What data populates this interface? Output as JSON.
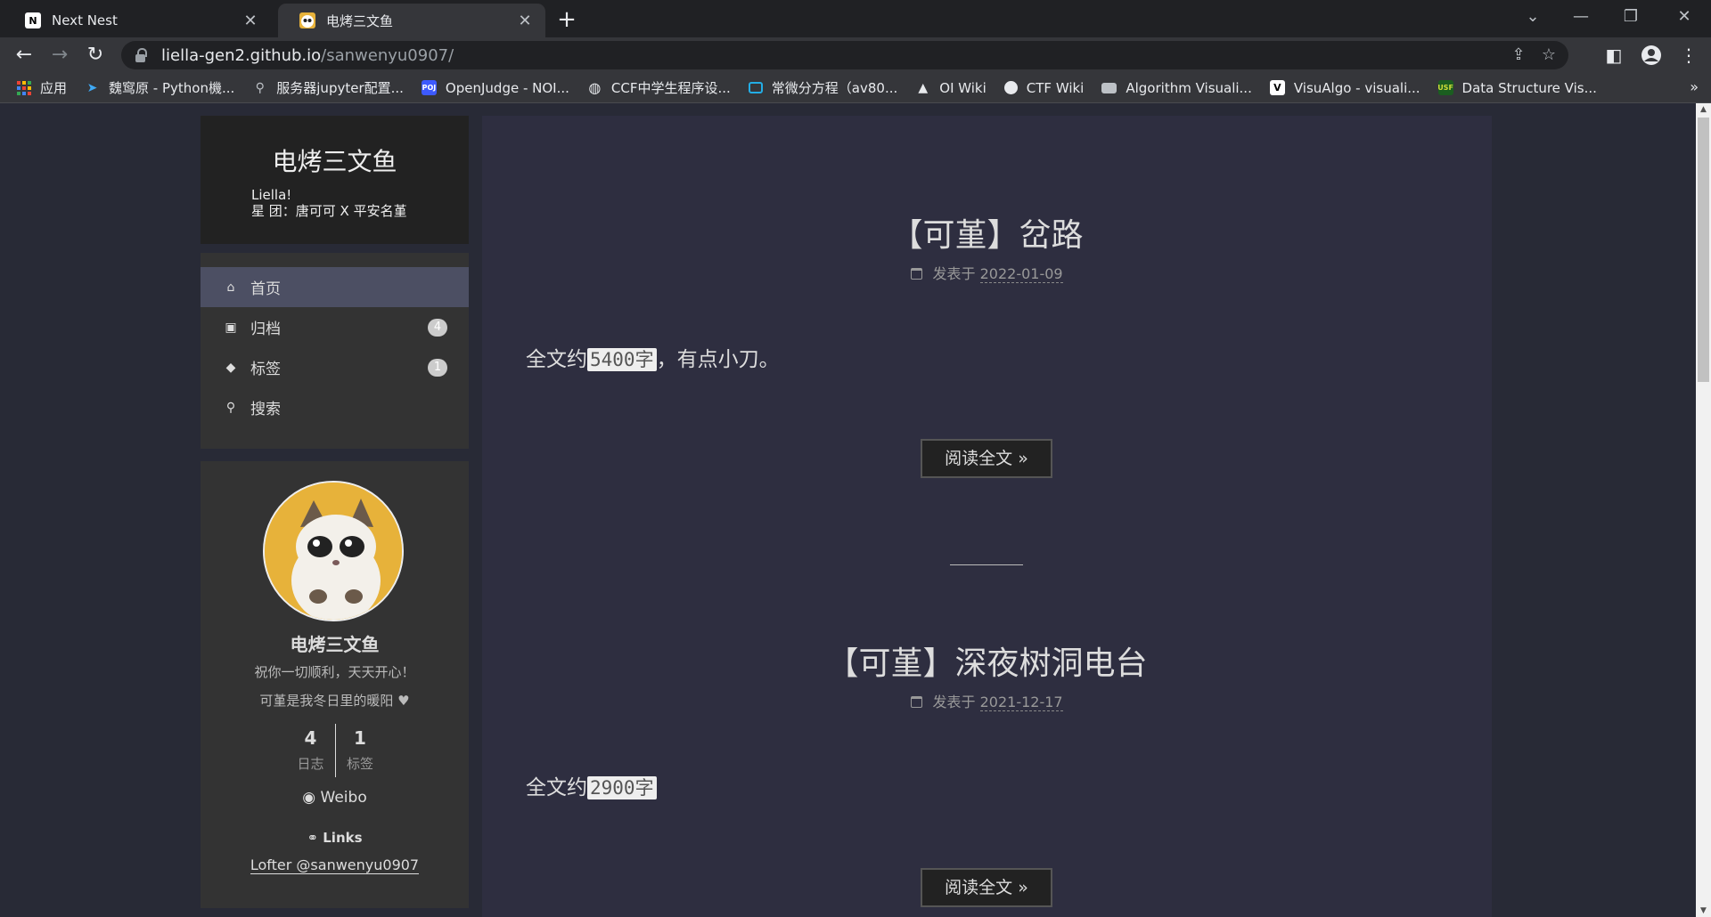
{
  "browser": {
    "tabs": [
      {
        "title": "Next Nest",
        "favicon": "N"
      },
      {
        "title": "电烤三文鱼",
        "favicon": "cat"
      }
    ],
    "url_host": "liella-gen2.github.io",
    "url_path": "/sanwenyu0907/",
    "bookmarks": [
      {
        "label": "应用",
        "icon": "apps-grid-icon",
        "color": "#4285f4"
      },
      {
        "label": "魏窎原 - Python機...",
        "icon": "bird-icon",
        "color": "#3fa9f5"
      },
      {
        "label": "服务器jupyter配置...",
        "icon": "link-icon",
        "color": "#bdc1c6"
      },
      {
        "label": "OpenJudge - NOI...",
        "icon": "poj-icon",
        "color": "#3d5afe"
      },
      {
        "label": "CCF中学生程序设...",
        "icon": "globe-icon",
        "color": "#e8eaed"
      },
      {
        "label": "常微分方程（av80...",
        "icon": "bilibili-icon",
        "color": "#23ade5"
      },
      {
        "label": "OI Wiki",
        "icon": "mortarboard-icon",
        "color": "#e8eaed"
      },
      {
        "label": "CTF Wiki",
        "icon": "shield-icon",
        "color": "#e8eaed"
      },
      {
        "label": "Algorithm Visuali...",
        "icon": "window-icon",
        "color": "#bdc1c6"
      },
      {
        "label": "VisuAlgo - visuali...",
        "icon": "visualgo-icon",
        "color": "#ffffff"
      },
      {
        "label": "Data Structure Vis...",
        "icon": "usf-icon",
        "color": "#cddc39"
      }
    ]
  },
  "site": {
    "title": "电烤三文鱼",
    "subtitle_line1": "Liella!",
    "subtitle_line2": "星 团：唐可可 X 平安名堇"
  },
  "menu": [
    {
      "label": "首页",
      "icon": "home-icon",
      "badge": ""
    },
    {
      "label": "归档",
      "icon": "archive-icon",
      "badge": "4"
    },
    {
      "label": "标签",
      "icon": "tags-icon",
      "badge": "1"
    },
    {
      "label": "搜索",
      "icon": "search-icon",
      "badge": ""
    }
  ],
  "profile": {
    "name": "电烤三文鱼",
    "desc1": "祝你一切顺利，天天开心！",
    "desc2": "可堇是我冬日里的暖阳 ♥",
    "posts_count": "4",
    "posts_label": "日志",
    "tags_count": "1",
    "tags_label": "标签",
    "weibo": "Weibo",
    "links_title": "Links",
    "link1": "Lofter @sanwenyu0907"
  },
  "posts": [
    {
      "title": "【可堇】岔路",
      "meta_prefix": "发表于",
      "date": "2022-01-09",
      "excerpt_prefix": "全文约",
      "excerpt_code": "5400字",
      "excerpt_suffix": "，有点小刀。",
      "readmore": "阅读全文 »"
    },
    {
      "title": "【可堇】深夜树洞电台",
      "meta_prefix": "发表于",
      "date": "2021-12-17",
      "excerpt_prefix": "全文约",
      "excerpt_code": "2900字",
      "excerpt_suffix": "",
      "readmore": "阅读全文 »"
    }
  ]
}
